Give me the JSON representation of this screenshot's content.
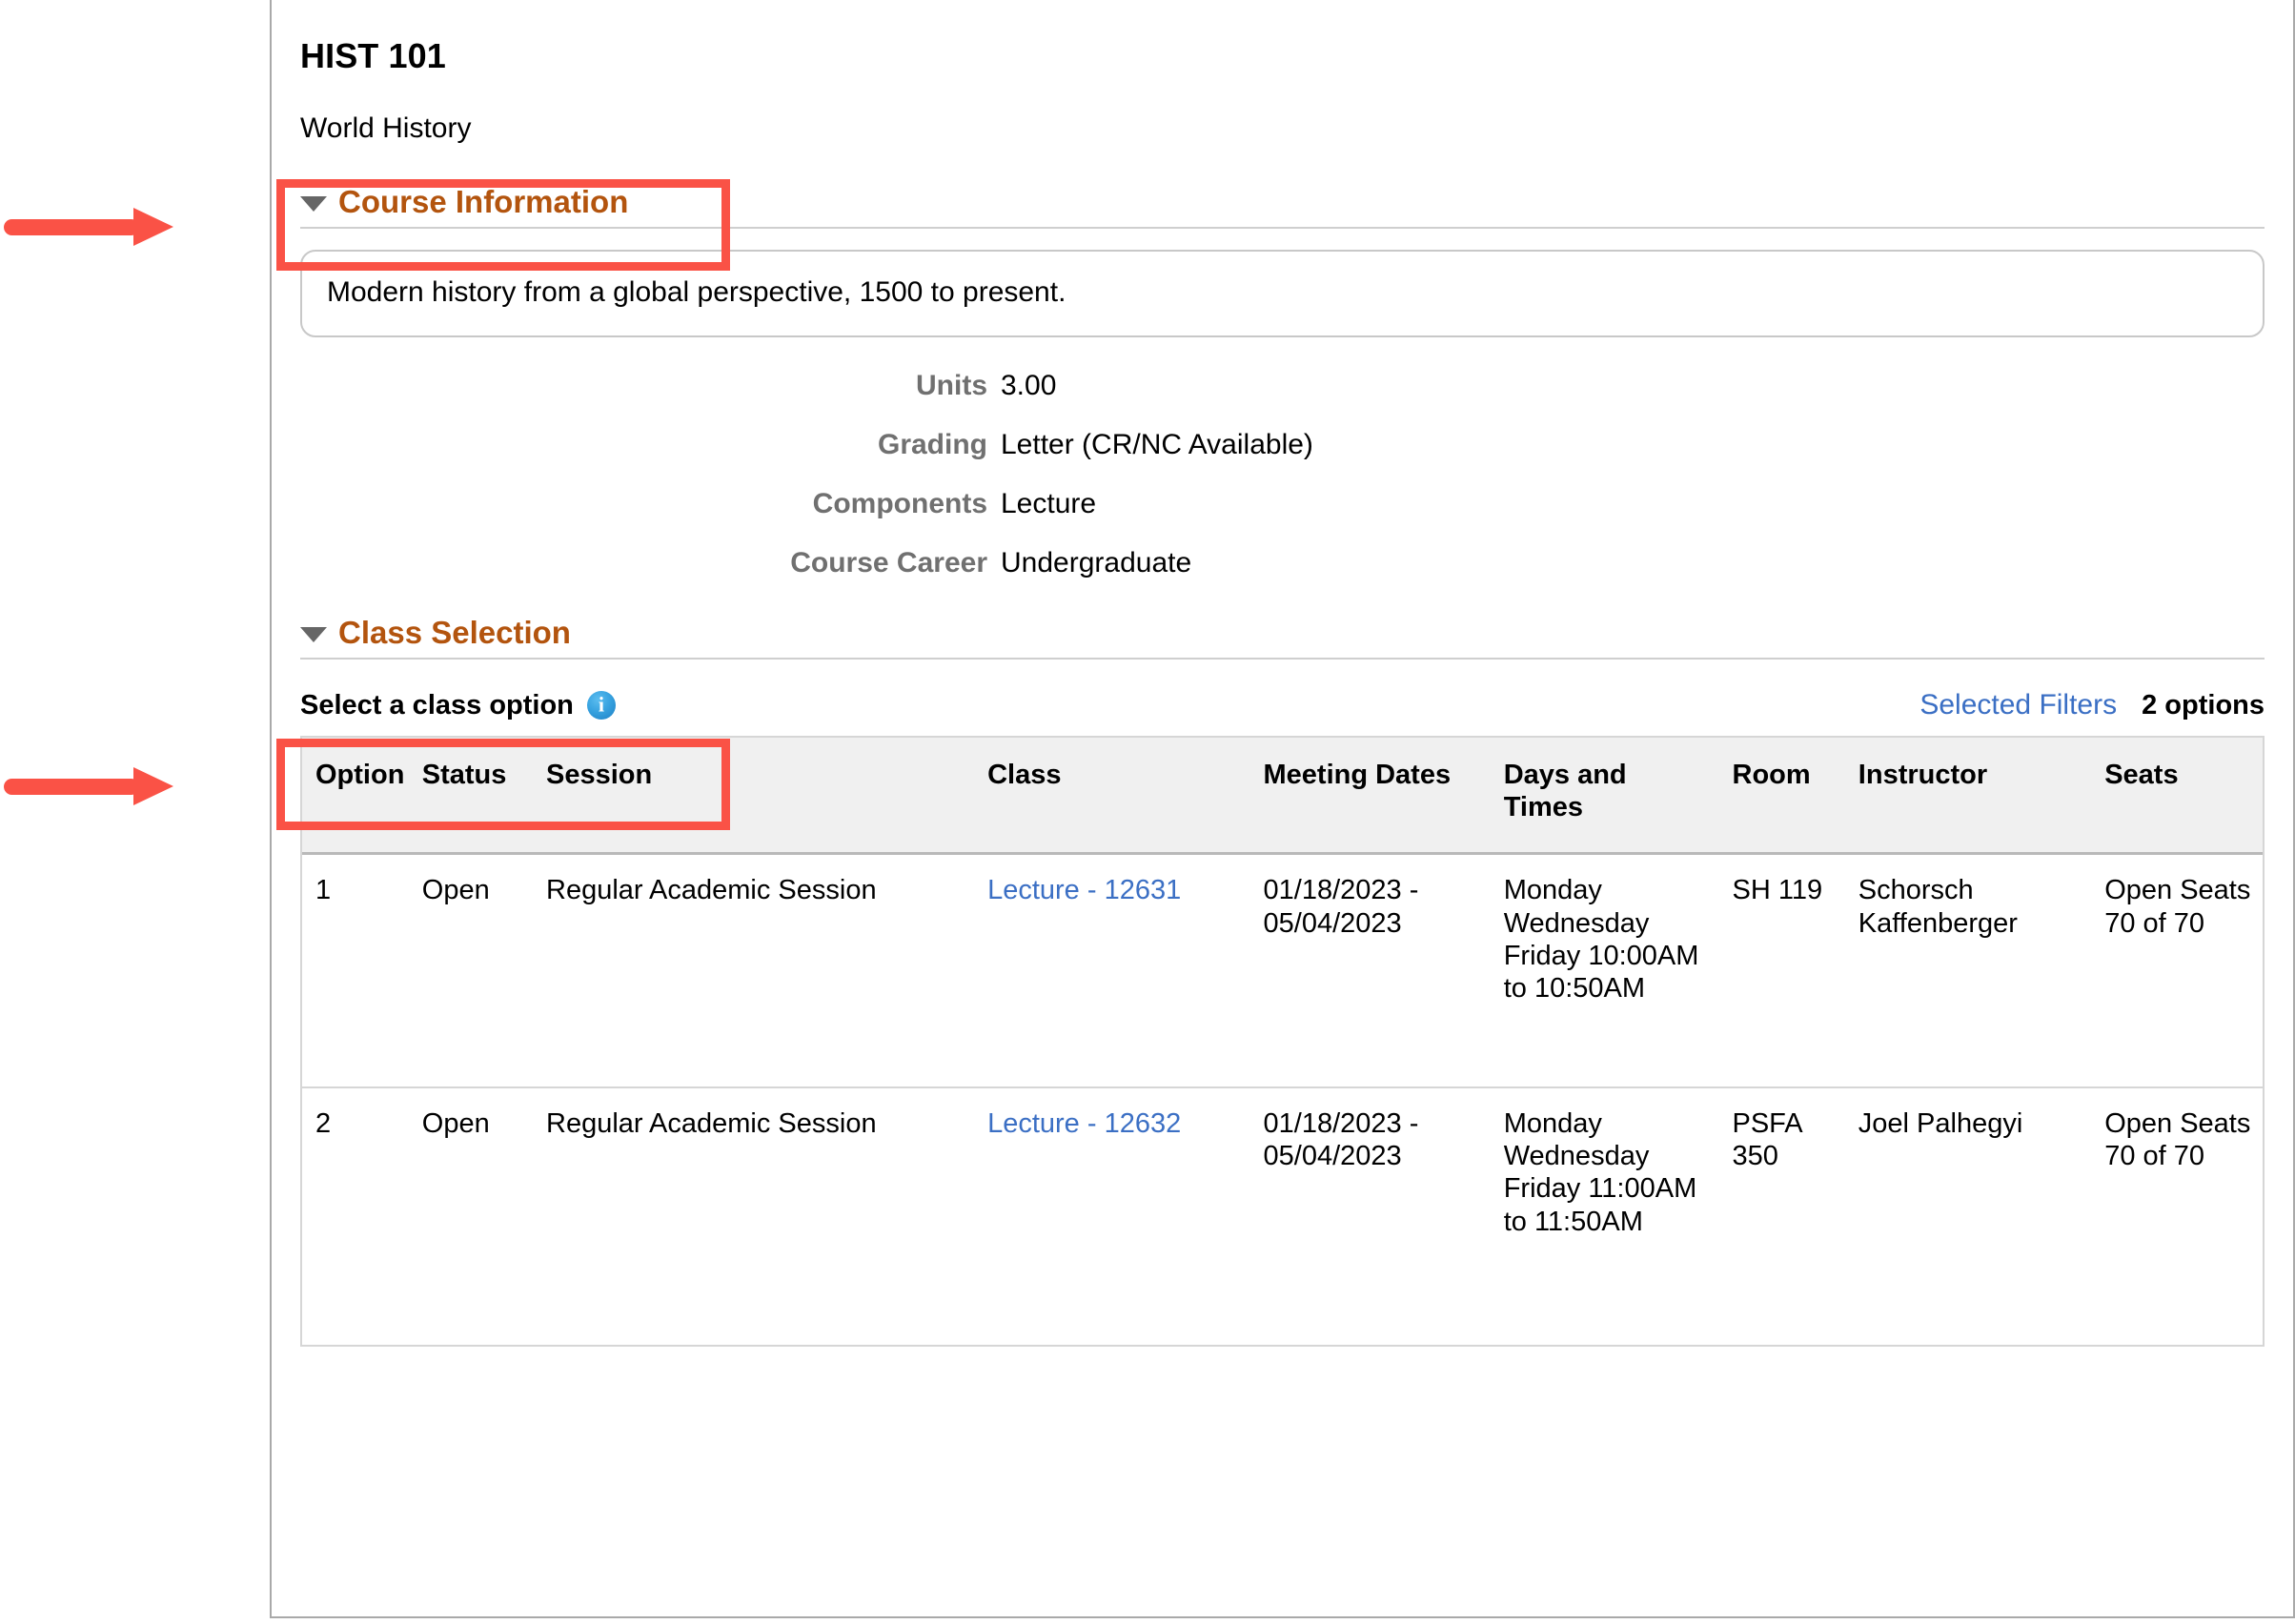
{
  "course": {
    "code": "HIST 101",
    "title": "World History",
    "description": "Modern history from a global perspective, 1500 to present."
  },
  "sections": {
    "course_information": {
      "label": "Course Information",
      "expanded": true,
      "caret_icon": "caret-down-icon"
    },
    "class_selection": {
      "label": "Class Selection",
      "expanded": true,
      "caret_icon": "caret-down-icon"
    }
  },
  "details": [
    {
      "label": "Units",
      "value": "3.00"
    },
    {
      "label": "Grading",
      "value": "Letter (CR/NC Available)"
    },
    {
      "label": "Components",
      "value": "Lecture"
    },
    {
      "label": "Course Career",
      "value": "Undergraduate"
    }
  ],
  "class_selection": {
    "prompt": "Select a class option",
    "info_icon": "info-icon",
    "filters_link": "Selected Filters",
    "options_count": "2 options",
    "columns": [
      "Option",
      "Status",
      "Session",
      "Class",
      "Meeting Dates",
      "Days and Times",
      "Room",
      "Instructor",
      "Seats"
    ],
    "rows": [
      {
        "option": "1",
        "status": "Open",
        "session": "Regular Academic Session",
        "class": "Lecture - 12631",
        "meeting_dates": "01/18/2023 - 05/04/2023",
        "days_and_times": "Monday Wednesday Friday 10:00AM to 10:50AM",
        "room": "SH 119",
        "instructor": "Schorsch Kaffenberger",
        "seats": "Open Seats 70 of 70"
      },
      {
        "option": "2",
        "status": "Open",
        "session": "Regular Academic Session",
        "class": "Lecture - 12632",
        "meeting_dates": "01/18/2023 - 05/04/2023",
        "days_and_times": "Monday Wednesday Friday 11:00AM to 11:50AM",
        "room": "PSFA 350",
        "instructor": "Joel Palhegyi",
        "seats": "Open Seats 70 of 70"
      }
    ]
  },
  "annotations": {
    "color": "#fa5246",
    "arrows": [
      {
        "name": "arrow-to-course-information",
        "target": "Course Information"
      },
      {
        "name": "arrow-to-class-selection",
        "target": "Class Selection"
      }
    ],
    "boxes": [
      {
        "name": "highlight-course-information",
        "target": "Course Information"
      },
      {
        "name": "highlight-class-selection",
        "target": "Class Selection"
      }
    ]
  },
  "theme": {
    "heading_color": "#b3540e",
    "link_color": "#3b6fc4",
    "label_color": "#707070",
    "annotation_color": "#fa5246"
  }
}
